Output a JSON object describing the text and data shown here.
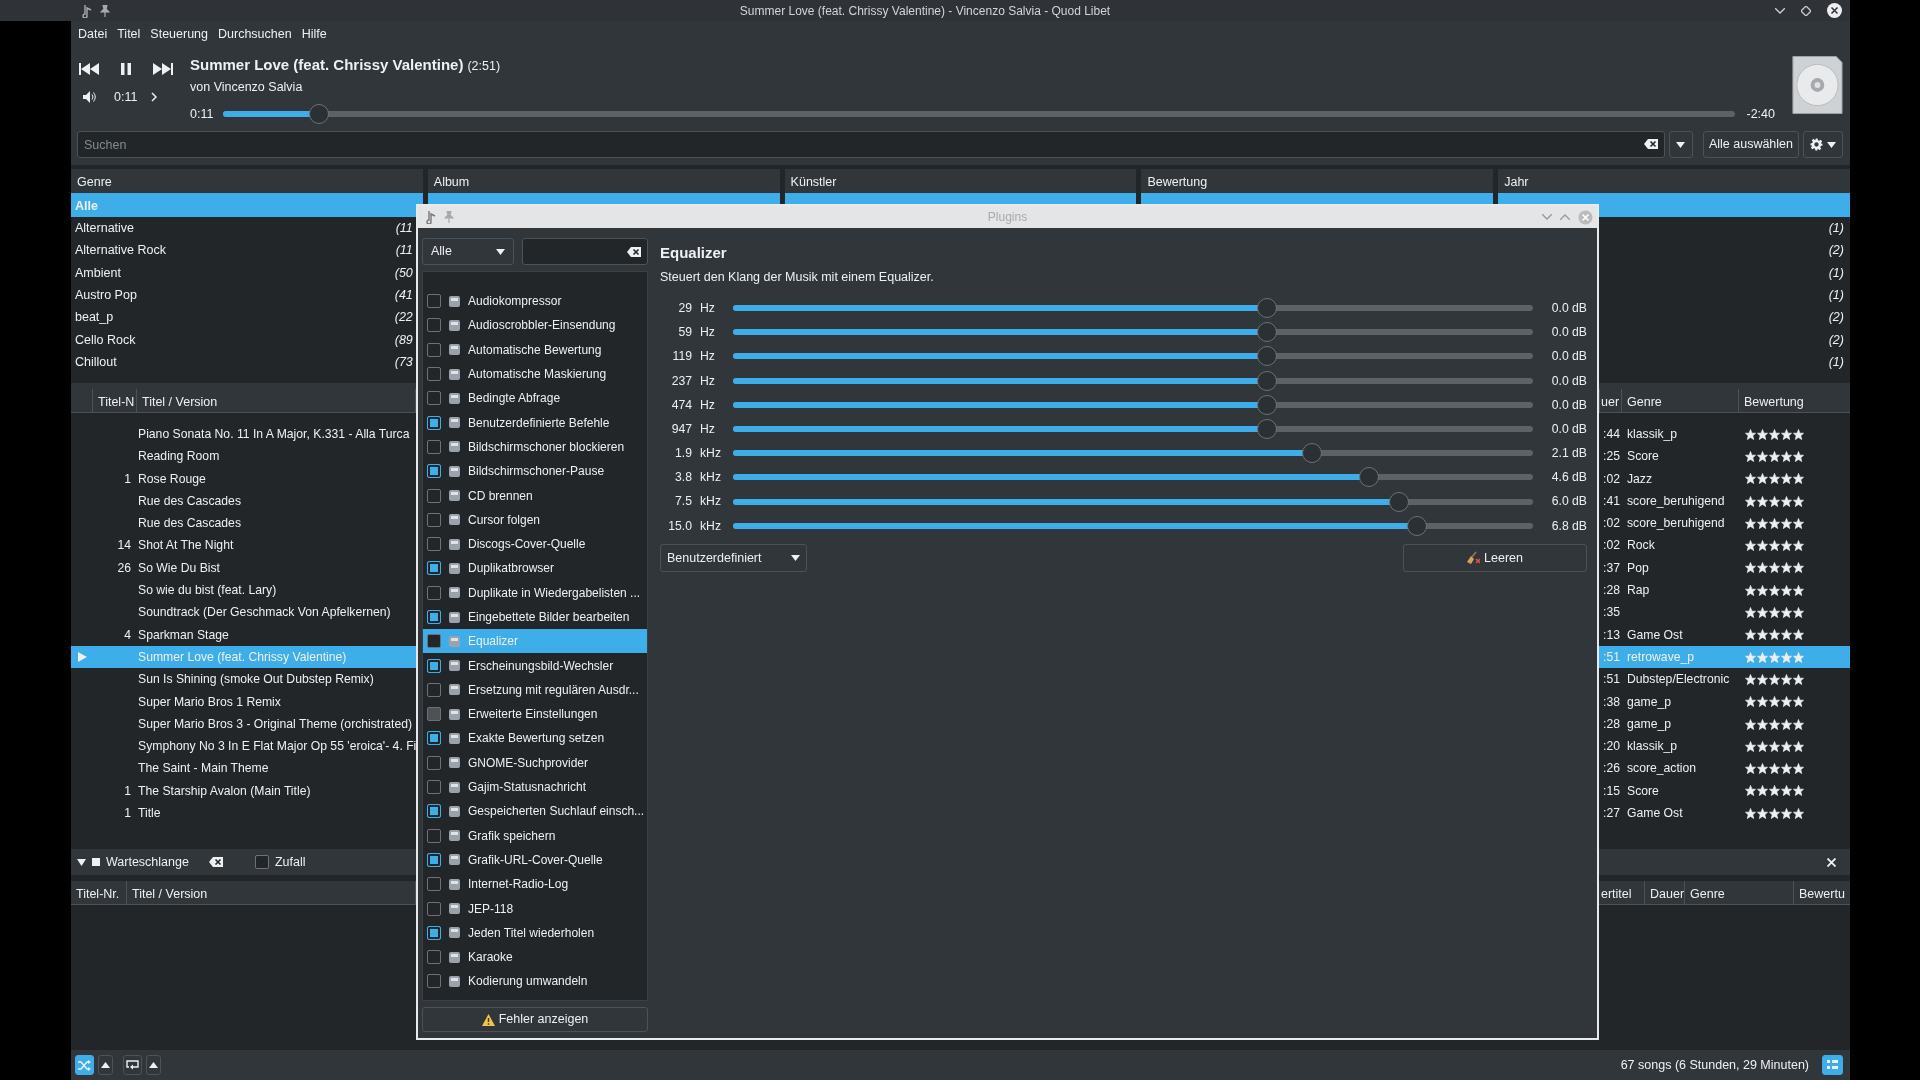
{
  "window": {
    "title": "Summer Love (feat. Chrissy Valentine) - Vincenzo Salvia - Quod Libet"
  },
  "menu": [
    "Datei",
    "Titel",
    "Steuerung",
    "Durchsuchen",
    "Hilfe"
  ],
  "player": {
    "title": "Summer Love (feat. Chrissy Valentine)",
    "length": "(2:51)",
    "artist": "von Vincenzo Salvia",
    "volume_time": "0:11",
    "elapsed": "0:11",
    "remaining": "-2:40",
    "level": 0.063,
    "playing": true
  },
  "search": {
    "placeholder": "Suchen",
    "select_all": "Alle auswählen"
  },
  "panes": [
    {
      "header": "Genre",
      "rows": [
        {
          "label": "Alle",
          "selected": true
        },
        {
          "label": "Alternative",
          "count": "(11",
          "selected": false
        },
        {
          "label": "Alternative Rock",
          "count": "(11",
          "selected": false
        },
        {
          "label": "Ambient",
          "count": "(50",
          "selected": false
        },
        {
          "label": "Austro Pop",
          "count": "(41",
          "selected": false
        },
        {
          "label": "beat_p",
          "count": "(22",
          "selected": false
        },
        {
          "label": "Cello Rock",
          "count": "(89",
          "selected": false
        },
        {
          "label": "Chillout",
          "count": "(73",
          "selected": false
        }
      ]
    },
    {
      "header": "Album",
      "rows": [
        {
          "selected": true
        }
      ]
    },
    {
      "header": "Künstler",
      "rows": [
        {
          "selected": true
        }
      ]
    },
    {
      "header": "Bewertung",
      "rows": [
        {
          "selected": true
        }
      ]
    },
    {
      "header": "Jahr",
      "rows": [
        {
          "selected": true
        },
        {
          "count": "(1)",
          "selected": false
        },
        {
          "count": "(2)",
          "selected": false
        },
        {
          "count": "(1)",
          "selected": false
        },
        {
          "count": "(1)",
          "selected": false
        },
        {
          "count": "(2)",
          "selected": false
        },
        {
          "count": "(2)",
          "selected": false
        },
        {
          "count": "(1)",
          "selected": false
        }
      ]
    }
  ],
  "songs": {
    "columns": [
      "Titel-N",
      "Titel / Version",
      "uer",
      "Genre",
      "Bewertung"
    ],
    "rows": [
      {
        "title": "Piano Sonata No. 11 In A Major, K.331 - Alla Turca",
        "duration": ":44",
        "genre": "klassik_p",
        "stars": 5,
        "selected": false,
        "playing": false
      },
      {
        "title": "Reading Room",
        "duration": ":25",
        "genre": "Score",
        "stars": 5,
        "selected": false,
        "playing": false
      },
      {
        "track": "1",
        "title": "Rose Rouge",
        "duration": ":02",
        "genre": "Jazz",
        "stars": 5,
        "selected": false,
        "playing": false
      },
      {
        "title": "Rue des Cascades",
        "duration": ":41",
        "genre": "score_beruhigend",
        "stars": 5,
        "selected": false,
        "playing": false
      },
      {
        "title": "Rue des Cascades",
        "duration": ":02",
        "genre": "score_beruhigend",
        "stars": 5,
        "selected": false,
        "playing": false
      },
      {
        "track": "14",
        "title": "Shot At The Night",
        "duration": ":02",
        "genre": "Rock",
        "stars": 5,
        "selected": false,
        "playing": false
      },
      {
        "track": "26",
        "title": "So Wie Du Bist",
        "duration": ":37",
        "genre": "Pop",
        "stars": 5,
        "selected": false,
        "playing": false
      },
      {
        "title": "So wie du bist (feat. Lary)",
        "duration": ":28",
        "genre": "Rap",
        "stars": 5,
        "selected": false,
        "playing": false
      },
      {
        "title": "Soundtrack (Der Geschmack Von Apfelkernen)",
        "duration": ":35",
        "stars": 5,
        "selected": false,
        "playing": false
      },
      {
        "track": "4",
        "title": "Sparkman Stage",
        "duration": ":13",
        "genre": "Game Ost",
        "stars": 5,
        "selected": false,
        "playing": false
      },
      {
        "title": "Summer Love (feat. Chrissy Valentine)",
        "duration": ":51",
        "genre": "retrowave_p",
        "stars": 5,
        "selected": true,
        "playing": true
      },
      {
        "title": "Sun Is Shining (smoke Out Dubstep Remix)",
        "duration": ":51",
        "genre": "Dubstep/Electronic",
        "stars": 5,
        "selected": false,
        "playing": false
      },
      {
        "title": "Super Mario Bros 1 Remix",
        "duration": ":38",
        "genre": "game_p",
        "stars": 5,
        "selected": false,
        "playing": false
      },
      {
        "title": "Super Mario Bros 3 - Original Theme (orchistrated)",
        "duration": ":28",
        "genre": "game_p",
        "stars": 5,
        "selected": false,
        "playing": false
      },
      {
        "title": "Symphony No 3 In E Flat Major Op 55 'eroica'- 4. Fi",
        "duration": ":20",
        "genre": "klassik_p",
        "stars": 5,
        "selected": false,
        "playing": false
      },
      {
        "title": "The Saint - Main Theme",
        "duration": ":26",
        "genre": "score_action",
        "stars": 5,
        "selected": false,
        "playing": false
      },
      {
        "track": "1",
        "title": "The Starship Avalon (Main Title)",
        "duration": ":15",
        "genre": "Score",
        "stars": 5,
        "selected": false,
        "playing": false
      },
      {
        "track": "1",
        "title": "Title",
        "duration": ":27",
        "genre": "Game Ost",
        "stars": 5,
        "selected": false,
        "playing": false
      }
    ]
  },
  "queue": {
    "expanded": true,
    "label": "Warteschlange",
    "shuffle": {
      "label": "Zufall",
      "checked": false
    },
    "columns": [
      "Titel-Nr.",
      "Titel / Version"
    ],
    "right_columns": [
      "ertitel",
      "Dauer",
      "Genre",
      "Bewertu"
    ]
  },
  "status": {
    "text": "67 songs (6 Stunden, 29 Minuten)",
    "shuffle_on": true,
    "repeat_on": false
  },
  "dialog": {
    "title": "Plugins",
    "filter": "Alle",
    "plugins": [
      {
        "name": "Audiokompressor",
        "checked": false,
        "selected": false,
        "disabled": false
      },
      {
        "name": "Audioscrobbler-Einsendung",
        "checked": false,
        "selected": false,
        "disabled": false
      },
      {
        "name": "Automatische Bewertung",
        "checked": false,
        "selected": false,
        "disabled": false
      },
      {
        "name": "Automatische Maskierung",
        "checked": false,
        "selected": false,
        "disabled": false
      },
      {
        "name": "Bedingte Abfrage",
        "checked": false,
        "selected": false,
        "disabled": false
      },
      {
        "name": "Benutzerdefinierte Befehle",
        "checked": true,
        "selected": false,
        "disabled": false
      },
      {
        "name": "Bildschirmschoner blockieren",
        "checked": false,
        "selected": false,
        "disabled": false
      },
      {
        "name": "Bildschirmschoner-Pause",
        "checked": true,
        "selected": false,
        "disabled": false
      },
      {
        "name": "CD brennen",
        "checked": false,
        "selected": false,
        "disabled": false
      },
      {
        "name": "Cursor folgen",
        "checked": false,
        "selected": false,
        "disabled": false
      },
      {
        "name": "Discogs-Cover-Quelle",
        "checked": false,
        "selected": false,
        "disabled": false
      },
      {
        "name": "Duplikatbrowser",
        "checked": true,
        "selected": false,
        "disabled": false
      },
      {
        "name": "Duplikate in Wiedergabelisten ...",
        "checked": false,
        "selected": false,
        "disabled": false
      },
      {
        "name": "Eingebettete Bilder bearbeiten",
        "checked": true,
        "selected": false,
        "disabled": false
      },
      {
        "name": "Equalizer",
        "checked": false,
        "selected": true,
        "disabled": false
      },
      {
        "name": "Erscheinungsbild-Wechsler",
        "checked": true,
        "selected": false,
        "disabled": false
      },
      {
        "name": "Ersetzung mit regulären Ausdr...",
        "checked": false,
        "selected": false,
        "disabled": false
      },
      {
        "name": "Erweiterte Einstellungen",
        "checked": false,
        "selected": false,
        "disabled": true
      },
      {
        "name": "Exakte Bewertung setzen",
        "checked": true,
        "selected": false,
        "disabled": false
      },
      {
        "name": "GNOME-Suchprovider",
        "checked": false,
        "selected": false,
        "disabled": false
      },
      {
        "name": "Gajim-Statusnachricht",
        "checked": false,
        "selected": false,
        "disabled": false
      },
      {
        "name": "Gespeicherten Suchlauf einsch...",
        "checked": true,
        "selected": false,
        "disabled": false
      },
      {
        "name": "Grafik speichern",
        "checked": false,
        "selected": false,
        "disabled": false
      },
      {
        "name": "Grafik-URL-Cover-Quelle",
        "checked": true,
        "selected": false,
        "disabled": false
      },
      {
        "name": "Internet-Radio-Log",
        "checked": false,
        "selected": false,
        "disabled": false
      },
      {
        "name": "JEP-118",
        "checked": false,
        "selected": false,
        "disabled": false
      },
      {
        "name": "Jeden Titel wiederholen",
        "checked": true,
        "selected": false,
        "disabled": false
      },
      {
        "name": "Karaoke",
        "checked": false,
        "selected": false,
        "disabled": false
      },
      {
        "name": "Kodierung umwandeln",
        "checked": false,
        "selected": false,
        "disabled": false
      }
    ],
    "error_button": "Fehler anzeigen",
    "equalizer": {
      "title": "Equalizer",
      "description": "Steuert den Klang der Musik mit einem Equalizer.",
      "bands": [
        {
          "frequency": "29",
          "unit": "Hz",
          "level": 0.667,
          "reading": "0.0 dB"
        },
        {
          "frequency": "59",
          "unit": "Hz",
          "level": 0.667,
          "reading": "0.0 dB"
        },
        {
          "frequency": "119",
          "unit": "Hz",
          "level": 0.667,
          "reading": "0.0 dB"
        },
        {
          "frequency": "237",
          "unit": "Hz",
          "level": 0.667,
          "reading": "0.0 dB"
        },
        {
          "frequency": "474",
          "unit": "Hz",
          "level": 0.667,
          "reading": "0.0 dB"
        },
        {
          "frequency": "947",
          "unit": "Hz",
          "level": 0.667,
          "reading": "0.0 dB"
        },
        {
          "frequency": "1.9",
          "unit": "kHz",
          "level": 0.724,
          "reading": "2.1 dB"
        },
        {
          "frequency": "3.8",
          "unit": "kHz",
          "level": 0.795,
          "reading": "4.6 dB"
        },
        {
          "frequency": "7.5",
          "unit": "kHz",
          "level": 0.833,
          "reading": "6.0 dB"
        },
        {
          "frequency": "15.0",
          "unit": "kHz",
          "level": 0.855,
          "reading": "6.8 dB"
        }
      ],
      "preset": "Benutzerdefiniert",
      "clear_button": "Leeren"
    }
  }
}
